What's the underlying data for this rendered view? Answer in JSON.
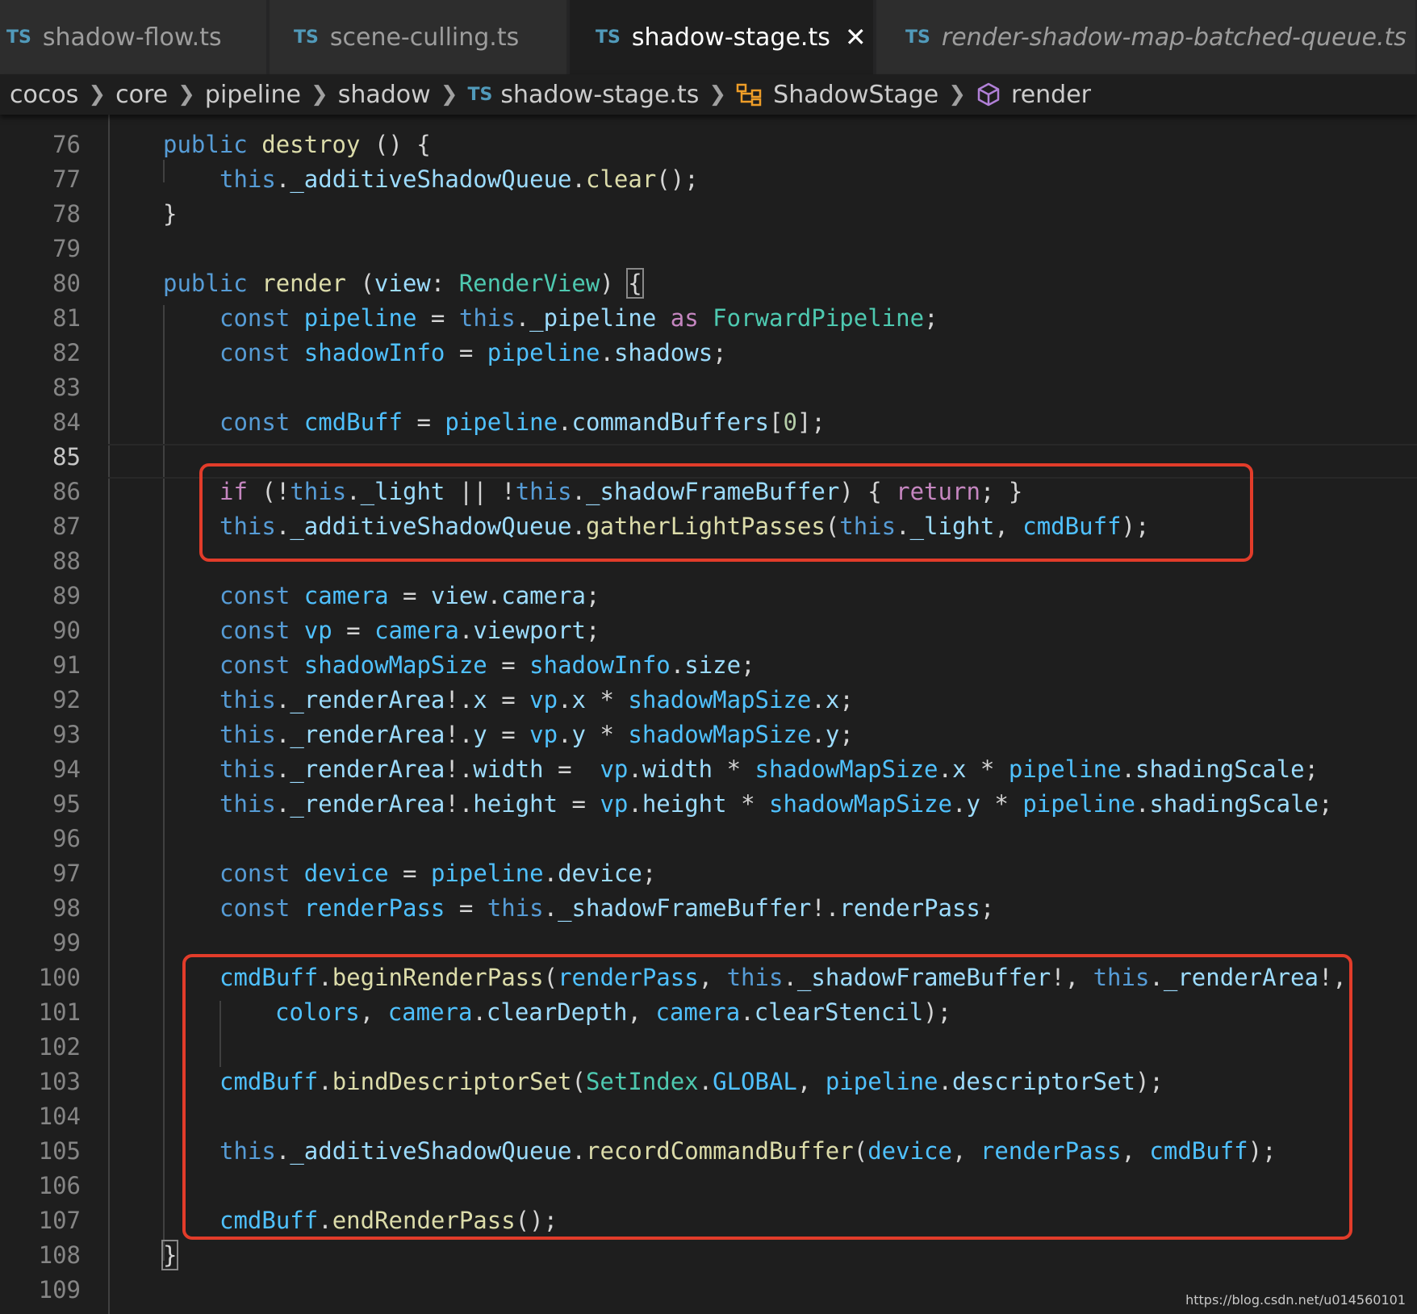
{
  "tabs": [
    {
      "badge": "TS",
      "label": "shadow-flow.ts",
      "active": false
    },
    {
      "badge": "TS",
      "label": "scene-culling.ts",
      "active": false
    },
    {
      "badge": "TS",
      "label": "shadow-stage.ts",
      "active": true
    },
    {
      "badge": "TS",
      "label": "render-shadow-map-batched-queue.ts",
      "active": false
    }
  ],
  "breadcrumb": {
    "items": [
      "cocos",
      "core",
      "pipeline",
      "shadow"
    ],
    "file_badge": "TS",
    "file": "shadow-stage.ts",
    "class_name": "ShadowStage",
    "method_name": "render"
  },
  "line_numbers": [
    "76",
    "77",
    "78",
    "79",
    "80",
    "81",
    "82",
    "83",
    "84",
    "85",
    "86",
    "87",
    "88",
    "89",
    "90",
    "91",
    "92",
    "93",
    "94",
    "95",
    "96",
    "97",
    "98",
    "99",
    "100",
    "101",
    "102",
    "103",
    "104",
    "105",
    "106",
    "107",
    "108",
    "109"
  ],
  "code": {
    "l76": {
      "kw": "public",
      "fn": "destroy",
      "rest": " () {"
    },
    "l77": {
      "this": "this",
      "rest1": ".",
      "prop": "_additiveShadowQueue",
      "rest2": ".",
      "fn": "clear",
      "rest3": "();"
    },
    "l78": {
      "text": "}"
    },
    "l80": {
      "kw": "public",
      "fn": "render",
      "p1": " (",
      "param": "view",
      "p2": ": ",
      "type": "RenderView",
      "p3": ") ",
      "brace": "{"
    },
    "l81": {
      "kw": "const",
      "var": "pipeline",
      "p1": " = ",
      "this": "this",
      "p2": ".",
      "prop": "_pipeline",
      "as": "as",
      "type": "ForwardPipeline",
      "p3": ";"
    },
    "l82": {
      "kw": "const",
      "var": "shadowInfo",
      "p1": " = ",
      "obj": "pipeline",
      "p2": ".",
      "prop": "shadows",
      "p3": ";"
    },
    "l84": {
      "kw": "const",
      "var": "cmdBuff",
      "p1": " = ",
      "obj": "pipeline",
      "p2": ".",
      "prop": "commandBuffers",
      "p3": "[",
      "num": "0",
      "p4": "];"
    },
    "l86": {
      "if": "if",
      "p1": " (!",
      "this1": "this",
      "p2": ".",
      "prop1": "_light",
      "p3": " || !",
      "this2": "this",
      "p4": ".",
      "prop2": "_shadowFrameBuffer",
      "p5": ") { ",
      "ret": "return",
      "p6": "; }"
    },
    "l87": {
      "this1": "this",
      "p1": ".",
      "prop": "_additiveShadowQueue",
      "p2": ".",
      "fn": "gatherLightPasses",
      "p3": "(",
      "this2": "this",
      "p4": ".",
      "prop2": "_light",
      "p5": ", ",
      "var": "cmdBuff",
      "p6": ");"
    },
    "l89": {
      "kw": "const",
      "var": "camera",
      "p1": " = ",
      "obj": "view",
      "p2": ".",
      "prop": "camera",
      "p3": ";"
    },
    "l90": {
      "kw": "const",
      "var": "vp",
      "p1": " = ",
      "obj": "camera",
      "p2": ".",
      "prop": "viewport",
      "p3": ";"
    },
    "l91": {
      "kw": "const",
      "var": "shadowMapSize",
      "p1": " = ",
      "obj": "shadowInfo",
      "p2": ".",
      "prop": "size",
      "p3": ";"
    },
    "l92": {
      "this": "this",
      "p1": ".",
      "prop": "_renderArea",
      "p2": "!.",
      "prop2": "x",
      "p3": " = ",
      "v1": "vp",
      "p4": ".",
      "pr1": "x",
      "p5": " * ",
      "v2": "shadowMapSize",
      "p6": ".",
      "pr2": "x",
      "p7": ";"
    },
    "l93": {
      "this": "this",
      "p1": ".",
      "prop": "_renderArea",
      "p2": "!.",
      "prop2": "y",
      "p3": " = ",
      "v1": "vp",
      "p4": ".",
      "pr1": "y",
      "p5": " * ",
      "v2": "shadowMapSize",
      "p6": ".",
      "pr2": "y",
      "p7": ";"
    },
    "l94": {
      "this": "this",
      "p1": ".",
      "prop": "_renderArea",
      "p2": "!.",
      "prop2": "width",
      "p3": " =  ",
      "v1": "vp",
      "p4": ".",
      "pr1": "width",
      "p5": " * ",
      "v2": "shadowMapSize",
      "p6": ".",
      "pr2": "x",
      "p7": " * ",
      "v3": "pipeline",
      "p8": ".",
      "pr3": "shadingScale",
      "p9": ";"
    },
    "l95": {
      "this": "this",
      "p1": ".",
      "prop": "_renderArea",
      "p2": "!.",
      "prop2": "height",
      "p3": " = ",
      "v1": "vp",
      "p4": ".",
      "pr1": "height",
      "p5": " * ",
      "v2": "shadowMapSize",
      "p6": ".",
      "pr2": "y",
      "p7": " * ",
      "v3": "pipeline",
      "p8": ".",
      "pr3": "shadingScale",
      "p9": ";"
    },
    "l97": {
      "kw": "const",
      "var": "device",
      "p1": " = ",
      "obj": "pipeline",
      "p2": ".",
      "prop": "device",
      "p3": ";"
    },
    "l98": {
      "kw": "const",
      "var": "renderPass",
      "p1": " = ",
      "this": "this",
      "p2": ".",
      "prop": "_shadowFrameBuffer",
      "p3": "!.",
      "prop2": "renderPass",
      "p4": ";"
    },
    "l100": {
      "obj": "cmdBuff",
      "p1": ".",
      "fn": "beginRenderPass",
      "p2": "(",
      "v1": "renderPass",
      "p3": ", ",
      "this1": "this",
      "p4": ".",
      "prop1": "_shadowFrameBuffer",
      "p5": "!, ",
      "this2": "this",
      "p6": ".",
      "prop2": "_renderArea",
      "p7": "!,"
    },
    "l101": {
      "v1": "colors",
      "p1": ", ",
      "v2": "camera",
      "p2": ".",
      "prop1": "clearDepth",
      "p3": ", ",
      "v3": "camera",
      "p4": ".",
      "prop2": "clearStencil",
      "p5": ");"
    },
    "l103": {
      "obj": "cmdBuff",
      "p1": ".",
      "fn": "bindDescriptorSet",
      "p2": "(",
      "type": "SetIndex",
      "p3": ".",
      "const": "GLOBAL",
      "p4": ", ",
      "v1": "pipeline",
      "p5": ".",
      "prop": "descriptorSet",
      "p6": ");"
    },
    "l105": {
      "this": "this",
      "p1": ".",
      "prop": "_additiveShadowQueue",
      "p2": ".",
      "fn": "recordCommandBuffer",
      "p3": "(",
      "v1": "device",
      "p4": ", ",
      "v2": "renderPass",
      "p5": ", ",
      "v3": "cmdBuff",
      "p6": ");"
    },
    "l107": {
      "obj": "cmdBuff",
      "p1": ".",
      "fn": "endRenderPass",
      "p2": "();"
    },
    "l108": {
      "text": "}"
    }
  },
  "watermark": "https://blog.csdn.net/u014560101",
  "colors": {
    "highlight_box": "#e23c2a",
    "keyword": "#569cd6",
    "function": "#dcdcaa",
    "type": "#4ec9b0",
    "variable": "#4fc1ff",
    "control": "#c586c0"
  }
}
